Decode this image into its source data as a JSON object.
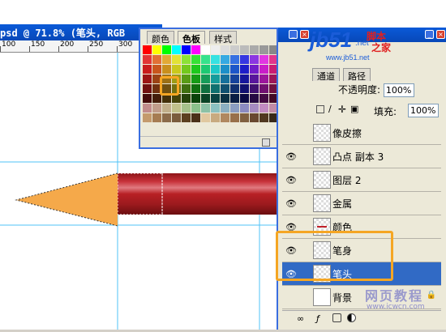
{
  "document": {
    "title": "psd @ 71.8% (笔头, RGB",
    "ruler_ticks": [
      "100",
      "150",
      "200",
      "250",
      "300"
    ]
  },
  "swatches_panel": {
    "tabs": [
      "颜色",
      "色板",
      "样式"
    ],
    "active_tab": "色板"
  },
  "watermark_logo": {
    "brand": "jb51",
    "suffix": ".net",
    "cn1": "脚本",
    "cn2": "之家",
    "url": "www.jb51.net"
  },
  "layers_panel": {
    "tabs": [
      "通道",
      "路径"
    ],
    "opacity_label": "不透明度:",
    "opacity_value": "100%",
    "fill_label": "填充:",
    "fill_value": "100%",
    "layers": [
      {
        "name": "像皮擦",
        "visible": false,
        "selected": false
      },
      {
        "name": "凸点 副本 3",
        "visible": true,
        "selected": false
      },
      {
        "name": "图层 2",
        "visible": true,
        "selected": false
      },
      {
        "name": "金属",
        "visible": true,
        "selected": false
      },
      {
        "name": "颜色",
        "visible": true,
        "selected": false
      },
      {
        "name": "笔身",
        "visible": true,
        "selected": false
      },
      {
        "name": "笔头",
        "visible": true,
        "selected": true
      },
      {
        "name": "背景",
        "visible": false,
        "selected": false
      }
    ]
  },
  "watermark_bottom": {
    "cn": "网页教程",
    "url": "www.icwcn.com"
  },
  "colors": {
    "pencil_tip": "#f5a94a",
    "pencil_body": "#b82025",
    "highlight": "#f5a623",
    "selection_blue": "#316ac5"
  }
}
